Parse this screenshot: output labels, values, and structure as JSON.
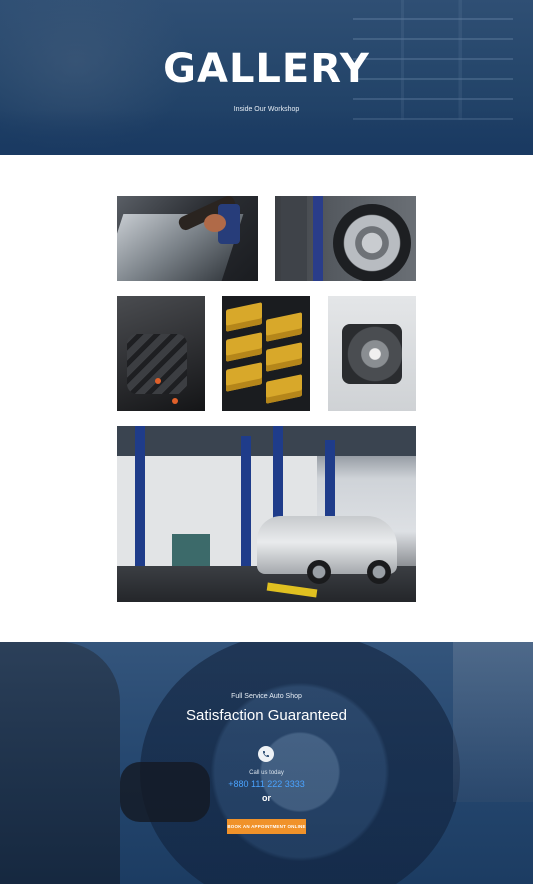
{
  "hero": {
    "title": "GALLERY",
    "subtitle": "Inside Our Workshop"
  },
  "gallery": {
    "images": [
      {
        "name": "windshield-repair"
      },
      {
        "name": "tire-change"
      },
      {
        "name": "engine-detail"
      },
      {
        "name": "parts-bins"
      },
      {
        "name": "engine-component"
      },
      {
        "name": "workshop-lift-car"
      }
    ]
  },
  "cta": {
    "kicker": "Full Service Auto Shop",
    "title": "Satisfaction Guaranteed",
    "call_label": "Call us today",
    "phone": "+880 111 222 3333",
    "or": "or",
    "button_label": "BOOK AN APPOINTMENT ONLINE",
    "button_color": "#f0922a",
    "phone_color": "#4aa3ff"
  },
  "icons": {
    "phone": "phone-icon"
  }
}
